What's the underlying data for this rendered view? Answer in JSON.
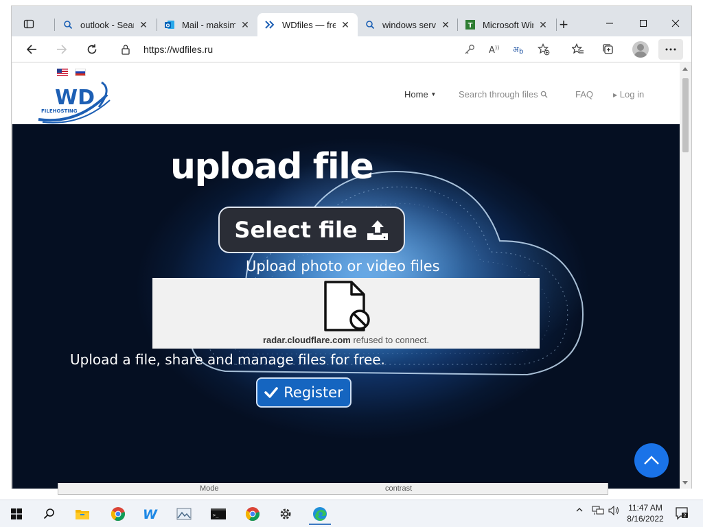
{
  "browser": {
    "tabs": [
      {
        "title": "outlook - Search",
        "icon": "search-icon",
        "active": false
      },
      {
        "title": "Mail - maksim",
        "icon": "outlook-icon",
        "active": false
      },
      {
        "title": "WDfiles — free",
        "icon": "wdfiles-icon",
        "active": true
      },
      {
        "title": "windows server",
        "icon": "search-icon",
        "active": false
      },
      {
        "title": "Microsoft Windows",
        "icon": "techcommunity-icon",
        "active": false
      }
    ],
    "url": "https://wdfiles.ru"
  },
  "site": {
    "logo_text": "WD",
    "logo_subtext": "FILEHOSTING",
    "nav": {
      "home": "Home",
      "search": "Search through files",
      "faq": "FAQ",
      "login": "Log in"
    },
    "hero": {
      "title": "upload file",
      "select_button": "Select file",
      "subtitle": "Upload photo or video files",
      "tagline": "Upload a file, share and manage files for free.",
      "register_button": "Register"
    },
    "error_frame": {
      "domain": "radar.cloudflare.com",
      "message": " refused to connect."
    }
  },
  "background_window": {
    "text_1": "Mode",
    "text_2": "contrast"
  },
  "taskbar": {
    "time": "11:47 AM",
    "date": "8/16/2022"
  },
  "colors": {
    "accent": "#1a73e8",
    "register": "#1565c0",
    "select_button_bg": "#2a2d36",
    "hero_dark": "#071731"
  }
}
